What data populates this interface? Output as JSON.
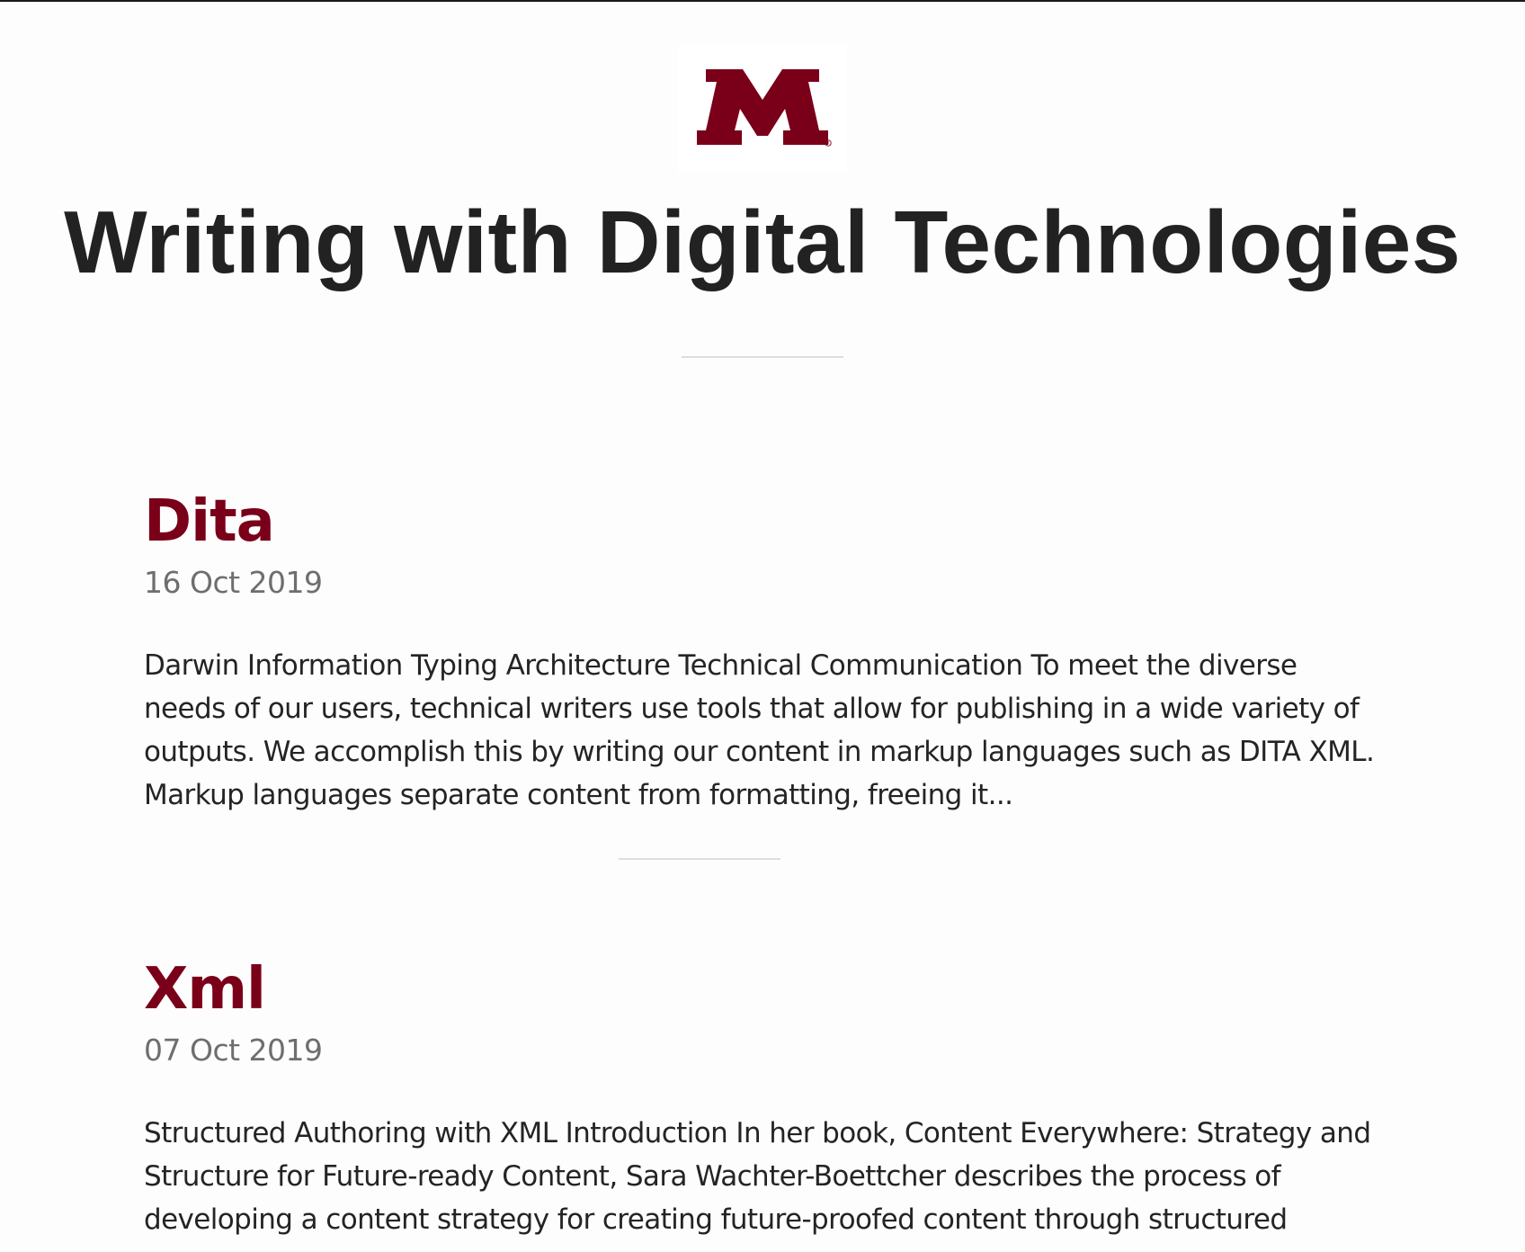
{
  "site": {
    "title": "Writing with Digital Technologies",
    "logo_icon": "university-m-logo",
    "brand_color": "#7a0019"
  },
  "posts": [
    {
      "title": "Dita",
      "date": "16 Oct 2019",
      "excerpt": "Darwin Information Typing Architecture Technical Communication To meet the diverse needs of our users, technical writers use tools that allow for publishing in a wide variety of outputs. We accomplish this by writing our content in markup languages such as DITA XML. Markup languages separate content from formatting, freeing it..."
    },
    {
      "title": "Xml",
      "date": "07 Oct 2019",
      "excerpt": "Structured Authoring with XML Introduction In her book, Content Everywhere: Strategy and Structure for Future-ready Content, Sara Wachter-Boettcher describes the process of developing a content strategy for creating future-proofed content through structured"
    }
  ]
}
